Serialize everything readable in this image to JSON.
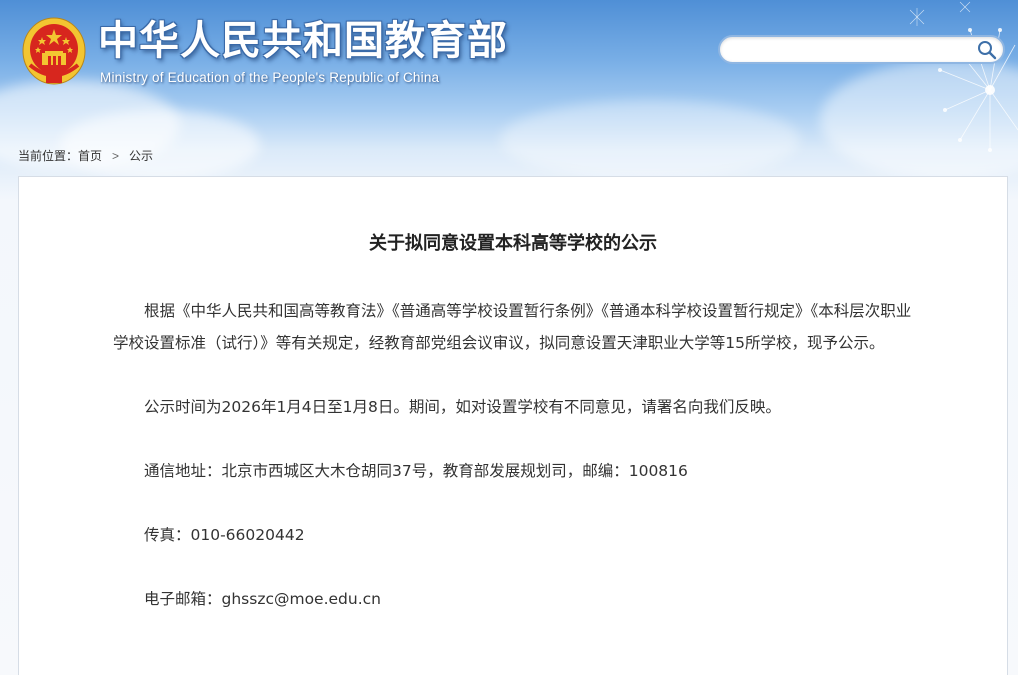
{
  "header": {
    "site_title": "中华人民共和国教育部",
    "site_subtitle": "Ministry of Education of the People's Republic of China",
    "emblem_icon": "national-emblem-icon"
  },
  "search": {
    "placeholder": "",
    "value": "",
    "icon": "search-icon"
  },
  "breadcrumb": {
    "prefix": "当前位置：",
    "home": "首页",
    "separator": ">",
    "current": "公示"
  },
  "article": {
    "title": "关于拟同意设置本科高等学校的公示",
    "paragraphs": [
      "根据《中华人民共和国高等教育法》《普通高等学校设置暂行条例》《普通本科学校设置暂行规定》《本科层次职业学校设置标准（试行）》等有关规定，经教育部党组会议审议，拟同意设置天津职业大学等15所学校，现予公示。",
      "公示时间为2026年1月4日至1月8日。期间，如对设置学校有不同意见，请署名向我们反映。",
      "通信地址：北京市西城区大木仓胡同37号，教育部发展规划司，邮编：100816",
      "传真：010-66020442",
      "电子邮箱：ghsszc@moe.edu.cn"
    ]
  },
  "colors": {
    "sky_top": "#4f8fd6",
    "page_bg": "#f7f9fc",
    "emblem_red": "#d7261e",
    "emblem_gold": "#f3c531",
    "text": "#333333"
  }
}
